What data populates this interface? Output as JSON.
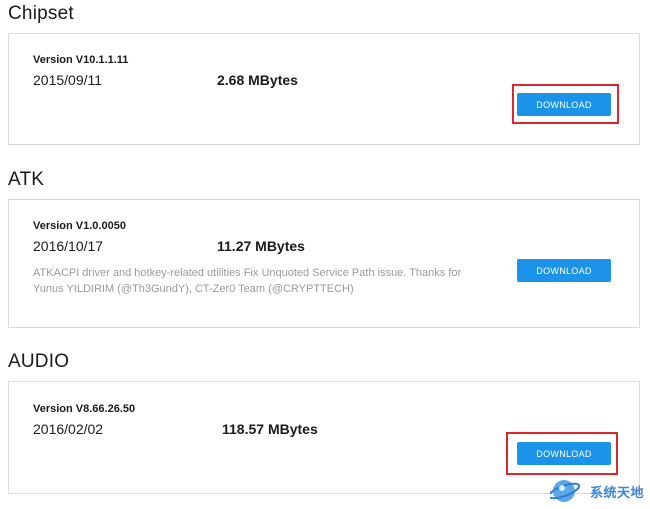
{
  "sections": [
    {
      "title": "Chipset",
      "version": "Version V10.1.1.11",
      "date": "2015/09/11",
      "size": "2.68 MBytes",
      "description": "",
      "button_label": "DOWNLOAD"
    },
    {
      "title": "ATK",
      "version": "Version V1.0.0050",
      "date": "2016/10/17",
      "size": "11.27 MBytes",
      "description": "ATKACPI driver and hotkey-related utilities Fix Unquoted Service Path issue. Thanks for Yunus YILDIRIM (@Th3GundY), CT-Zer0 Team (@CRYPTTECH)",
      "button_label": "DOWNLOAD"
    },
    {
      "title": "AUDIO",
      "version": "Version V8.66.26.50",
      "date": "2016/02/02",
      "size": "118.57 MBytes",
      "description": "",
      "button_label": "DOWNLOAD"
    }
  ],
  "watermark": {
    "text": "系统天地",
    "icon": "xitongtiandi-logo-icon"
  },
  "colors": {
    "button": "#1a93e8",
    "highlight": "#d9292c",
    "border": "#dcdcdc"
  }
}
